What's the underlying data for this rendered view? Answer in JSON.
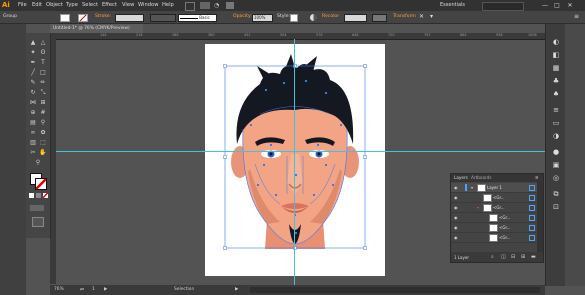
{
  "app": {
    "logo": "Ai",
    "menu": [
      "File",
      "Edit",
      "Object",
      "Type",
      "Select",
      "Effect",
      "View",
      "Window",
      "Help"
    ],
    "workspace": "Essentials",
    "window_controls": [
      "—",
      "□",
      "✕"
    ]
  },
  "controlbar": {
    "selection": "Group",
    "stroke_label": "Stroke:",
    "brush": "Basic",
    "opacity_label": "Opacity:",
    "opacity_value": "100%",
    "style_label": "Style:",
    "recolor_label": "Recolor",
    "transform_label": "Transform"
  },
  "document": {
    "tab_title": "Untitled-1* @ 76% (CMYK/Preview)",
    "ruler_ticks": [
      "144",
      "216",
      "288",
      "360",
      "432",
      "504",
      "576",
      "648",
      "720",
      "792",
      "864",
      "936",
      "1008"
    ]
  },
  "layers_panel": {
    "tabs": [
      "Layers",
      "Artboards"
    ],
    "rows": [
      {
        "name": "Layer 1"
      },
      {
        "name": "<Gr..."
      },
      {
        "name": "<Gr..."
      },
      {
        "name": "<Gr..."
      },
      {
        "name": "<Gr..."
      },
      {
        "name": "<Gr..."
      }
    ],
    "footer": "1 Layer"
  },
  "statusbar": {
    "zoom": "76%",
    "page": "1",
    "tool": "Selection"
  },
  "colors": {
    "accent_orange": "#ff9a00",
    "guide_cyan": "#3ec3e0",
    "skin": "#f3a485",
    "hair": "#141820",
    "path_blue": "#3a78f0"
  },
  "icons": {
    "tools": [
      "selection-icon",
      "direct-selection-icon",
      "magic-wand-icon",
      "lasso-icon",
      "pen-icon",
      "type-icon",
      "line-icon",
      "rectangle-icon",
      "paintbrush-icon",
      "pencil-icon",
      "rotate-icon",
      "scale-icon",
      "width-icon",
      "free-transform-icon",
      "shape-builder-icon",
      "mesh-icon",
      "gradient-icon",
      "eyedropper-icon",
      "blend-icon",
      "symbol-icon",
      "graph-icon",
      "artboard-icon",
      "slice-icon",
      "hand-icon",
      "zoom-icon"
    ]
  }
}
